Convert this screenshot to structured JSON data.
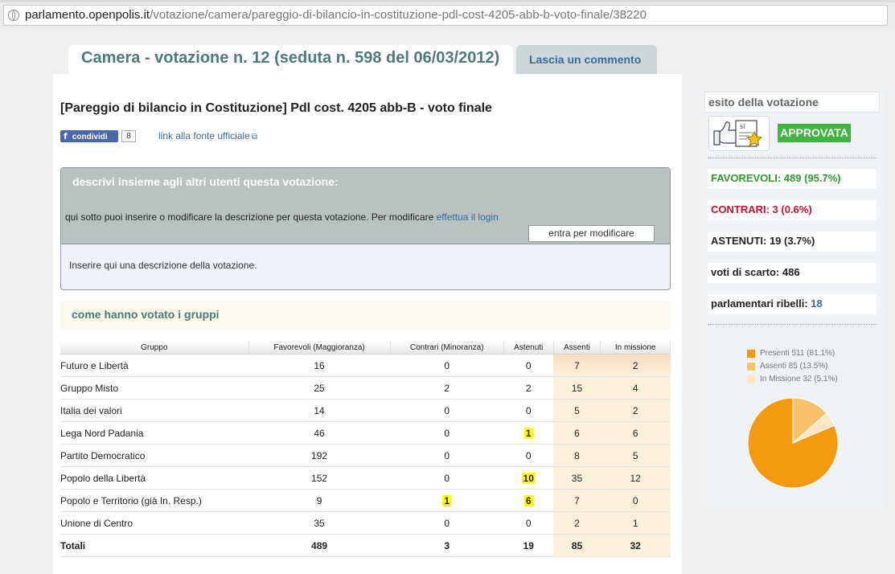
{
  "browser": {
    "url_host": "parlamento.openpolis.it",
    "url_path": "/votazione/camera/pareggio-di-bilancio-in-costituzione-pdl-cost-4205-abb-b-voto-finale/38220"
  },
  "tabs": {
    "main": "Camera - votazione n. 12 (seduta n. 598 del 06/03/2012)",
    "comment": "Lascia un commento"
  },
  "vote_title": "[Pareggio di bilancio in Costituzione] Pdl cost. 4205 abb-B - voto finale",
  "share": {
    "button": "condividi",
    "count": "8",
    "source_link": "link alla fonte ufficiale"
  },
  "description": {
    "heading": "descrivi insieme agli altri utenti questa votazione:",
    "text": "qui sotto puoi inserire o modificare la descrizione per questa votazione. Per modificare",
    "login_link": "effettua il login",
    "edit_button": "entra per modificare",
    "placeholder": "Inserire qui una descrizione della votazione."
  },
  "groups_heading": "come hanno votato i gruppi",
  "table": {
    "headers": [
      "Gruppo",
      "Favorevoli (Maggioranza)",
      "Contrari (Minoranza)",
      "Astenuti",
      "Assenti",
      "In missione"
    ],
    "rows": [
      [
        "Futuro e Libertà",
        "16",
        "0",
        "0",
        "7",
        "2"
      ],
      [
        "Gruppo Misto",
        "25",
        "2",
        "2",
        "15",
        "4"
      ],
      [
        "Italia dei valori",
        "14",
        "0",
        "0",
        "5",
        "2"
      ],
      [
        "Lega Nord Padania",
        "46",
        "0",
        "1",
        "6",
        "6"
      ],
      [
        "Partito Democratico",
        "192",
        "0",
        "0",
        "8",
        "5"
      ],
      [
        "Popolo della Libertà",
        "152",
        "0",
        "10",
        "35",
        "12"
      ],
      [
        "Popolo e Territorio (già In. Resp.)",
        "9",
        "1",
        "6",
        "7",
        "0"
      ],
      [
        "Unione di Centro",
        "35",
        "0",
        "0",
        "2",
        "1"
      ]
    ],
    "totals": [
      "Totali",
      "489",
      "3",
      "19",
      "85",
      "32"
    ]
  },
  "sidebar": {
    "esito_label": "esito della votazione",
    "result": "APPROVATA",
    "favorevoli": "FAVOREVOLI: 489 (95.7%)",
    "contrari": "CONTRARI: 3 (0.6%)",
    "astenuti": "ASTENUTI: 19 (3.7%)",
    "scarto_label": "voti di scarto:",
    "scarto_value": "486",
    "ribelli_label": "parlamentari ribelli:",
    "ribelli_value": "18",
    "icon": "thumbs-up-star-icon"
  },
  "colors": {
    "favorevoli": "#2e9a2e",
    "contrari": "#c8102e",
    "astenuti": "#222222",
    "approvata_bg": "#3fb53f"
  },
  "chart_data": {
    "type": "pie",
    "legend_position": "top",
    "labels": [
      "Presenti 511 (81.1%)",
      "Assenti 85 (13.5%)",
      "In Missione 32 (5.1%)"
    ],
    "values": [
      511,
      85,
      32
    ],
    "colors": [
      "#f39a10",
      "#f8c16a",
      "#fde7c6"
    ]
  }
}
